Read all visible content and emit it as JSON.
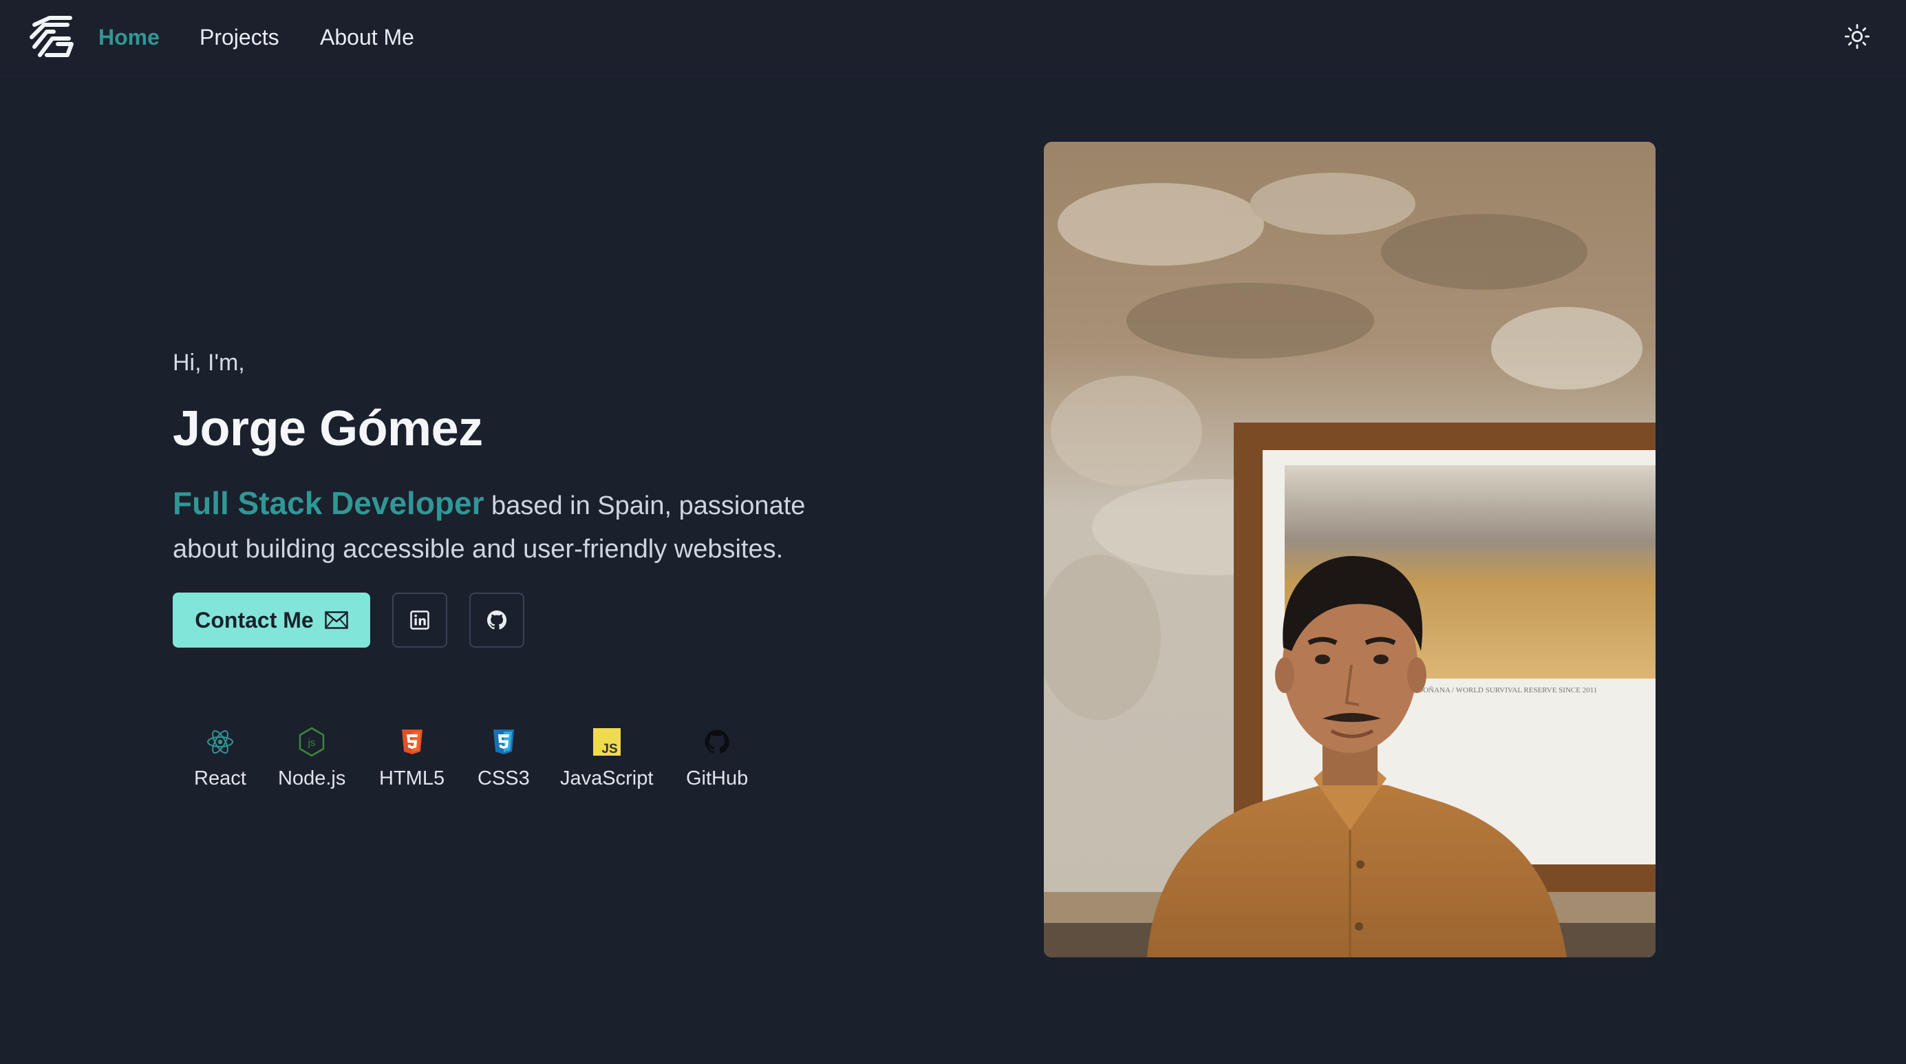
{
  "nav": {
    "links": [
      {
        "label": "Home",
        "active": true
      },
      {
        "label": "Projects",
        "active": false
      },
      {
        "label": "About Me",
        "active": false
      }
    ]
  },
  "hero": {
    "greeting": "Hi, I'm,",
    "name": "Jorge Gómez",
    "role": "Full Stack Developer",
    "tagline_line1": " based in Spain, passionate",
    "tagline_line2": "about building accessible and user-friendly websites.",
    "contact_label": "Contact Me"
  },
  "skills": [
    {
      "label": "React",
      "icon": "react-icon",
      "color": "#61dafb"
    },
    {
      "label": "Node.js",
      "icon": "nodejs-icon",
      "color": "#3c873a"
    },
    {
      "label": "HTML5",
      "icon": "html5-icon",
      "color": "#e34f26"
    },
    {
      "label": "CSS3",
      "icon": "css3-icon",
      "color": "#1572b6"
    },
    {
      "label": "JavaScript",
      "icon": "javascript-icon",
      "color": "#f0db4f"
    },
    {
      "label": "GitHub",
      "icon": "github-icon",
      "color": "#000000"
    }
  ],
  "photo": {
    "frame_caption": "...DOÑANA / WORLD SURVIVAL RESERVE SINCE 2011"
  },
  "colors": {
    "background": "#1a202c",
    "accent": "#319795",
    "button": "#81e6d9"
  }
}
